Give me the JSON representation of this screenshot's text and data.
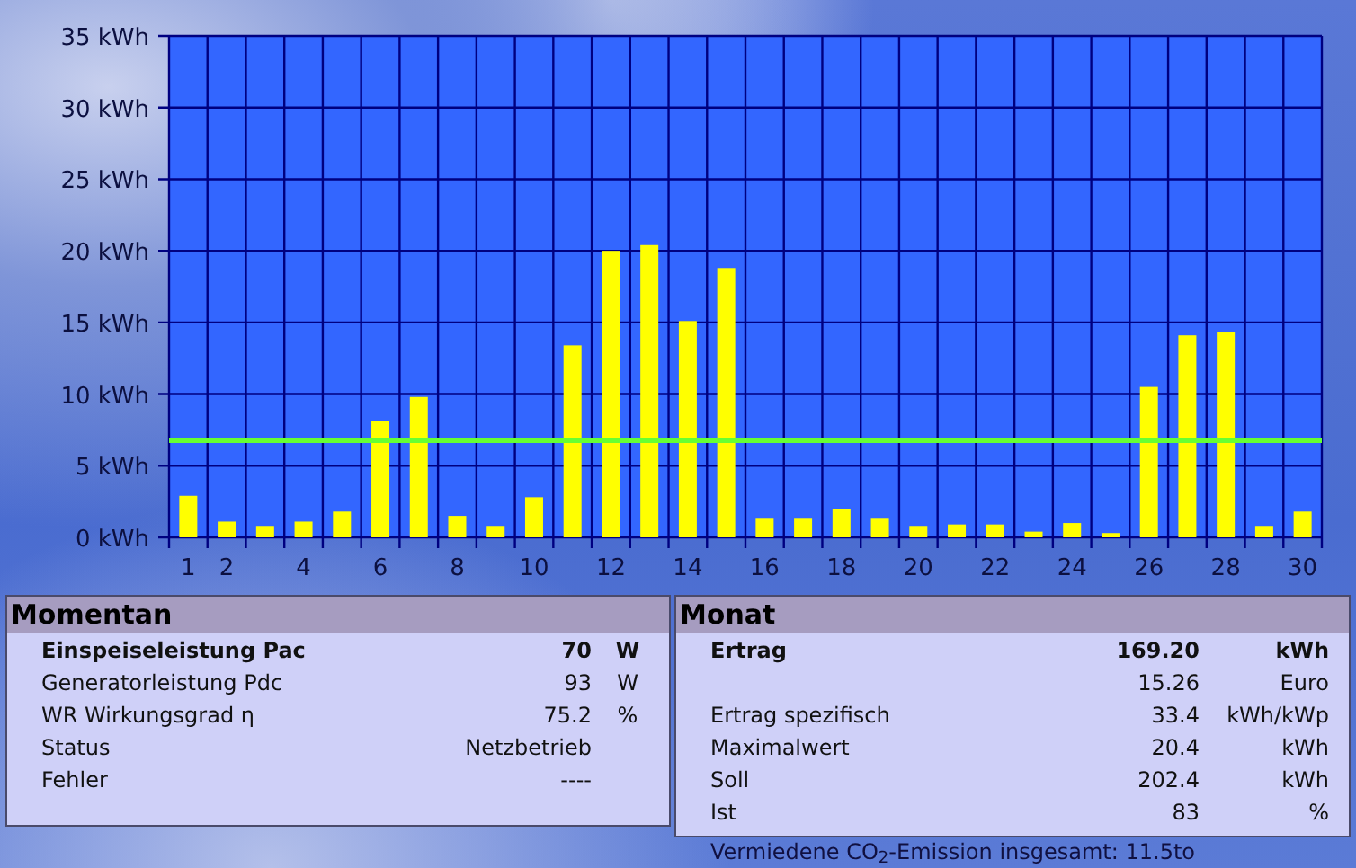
{
  "chart": {
    "chart_data": {
      "type": "bar",
      "x": [
        1,
        2,
        3,
        4,
        5,
        6,
        7,
        8,
        9,
        10,
        11,
        12,
        13,
        14,
        15,
        16,
        17,
        18,
        19,
        20,
        21,
        22,
        23,
        24,
        25,
        26,
        27,
        28,
        29,
        30
      ],
      "xlim": [
        0.5,
        30.5
      ],
      "grid": true,
      "series": [
        {
          "color": "#ffff00",
          "values": [
            2.9,
            1.1,
            0.8,
            1.1,
            1.8,
            8.1,
            9.8,
            1.5,
            0.8,
            2.8,
            13.4,
            20.0,
            20.4,
            15.1,
            18.8,
            1.3,
            1.3,
            2.0,
            1.3,
            0.8,
            0.9,
            0.9,
            0.4,
            1.0,
            0.3,
            10.5,
            14.1,
            14.3,
            0.8,
            1.8
          ]
        }
      ],
      "ylim": [
        0,
        35
      ],
      "yticks": [
        {
          "value": 0,
          "label": "0 kWh"
        },
        {
          "value": 5,
          "label": "5 kWh"
        },
        {
          "value": 10,
          "label": "10 kWh"
        },
        {
          "value": 15,
          "label": "15 kWh"
        },
        {
          "value": 20,
          "label": "20 kWh"
        },
        {
          "value": 25,
          "label": "25 kWh"
        },
        {
          "value": 30,
          "label": "30 kWh"
        },
        {
          "value": 35,
          "label": "35 kWh"
        }
      ],
      "xticks": [
        1,
        2,
        4,
        6,
        8,
        10,
        12,
        14,
        16,
        18,
        20,
        22,
        24,
        26,
        28,
        30
      ],
      "ref_lines": [
        {
          "axis": "y",
          "value": 6.75,
          "color": "#66ff33"
        }
      ]
    }
  },
  "momentan": {
    "title": "Momentan",
    "rows": [
      {
        "label": "Einspeiseleistung Pac",
        "value": "70",
        "unit": "W",
        "bold": true
      },
      {
        "label": "Generatorleistung Pdc",
        "value": "93",
        "unit": "W",
        "bold": false
      },
      {
        "label": "WR Wirkungsgrad η",
        "value": "75.2",
        "unit": "%",
        "bold": false
      },
      {
        "label": "Status",
        "value": "Netzbetrieb",
        "bold": false
      },
      {
        "label": "Fehler",
        "value": "----",
        "bold": false
      }
    ]
  },
  "monat": {
    "title": "Monat",
    "rows": [
      {
        "label": "Ertrag",
        "value": "169.20",
        "unit": "kWh",
        "bold": true
      },
      {
        "value": "15.26",
        "unit": "Euro",
        "bold": false
      },
      {
        "label": "Ertrag spezifisch",
        "value": "33.4",
        "unit": "kWh/kWp",
        "bold": false
      },
      {
        "label": "Maximalwert",
        "value": "20.4",
        "unit": "kWh",
        "bold": false
      },
      {
        "label": "Soll",
        "value": "202.4",
        "unit": "kWh",
        "bold": false
      },
      {
        "label": "Ist",
        "value": "83",
        "unit": "%",
        "bold": false
      }
    ]
  },
  "footer": "Vermiedene CO$_{2}$-Emission insgesamt: 11.5to"
}
